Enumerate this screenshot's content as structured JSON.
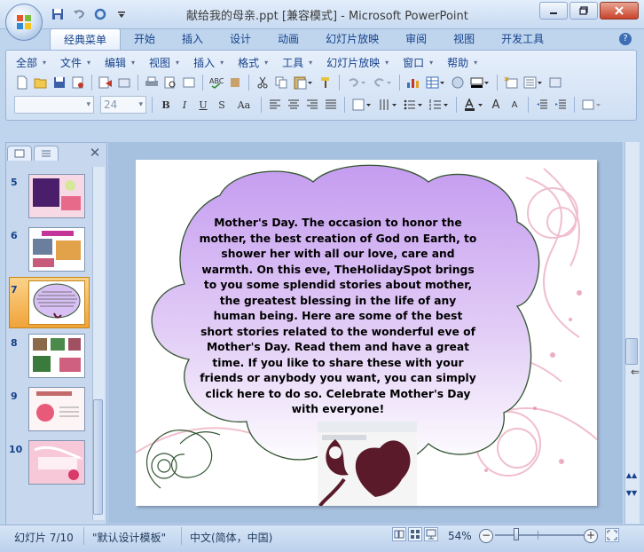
{
  "window": {
    "title": "献给我的母亲.ppt [兼容模式] - Microsoft PowerPoint",
    "controls": [
      "minimize",
      "restore",
      "close"
    ]
  },
  "quick_access": [
    "save-icon",
    "undo-icon",
    "redo-icon",
    "customize-icon"
  ],
  "ribbon": {
    "tabs": [
      {
        "label": "经典菜单",
        "active": true
      },
      {
        "label": "开始",
        "active": false
      },
      {
        "label": "插入",
        "active": false
      },
      {
        "label": "设计",
        "active": false
      },
      {
        "label": "动画",
        "active": false
      },
      {
        "label": "幻灯片放映",
        "active": false
      },
      {
        "label": "审阅",
        "active": false
      },
      {
        "label": "视图",
        "active": false
      },
      {
        "label": "开发工具",
        "active": false
      }
    ],
    "help_label": "?",
    "menus": [
      "全部",
      "文件",
      "编辑",
      "视图",
      "插入",
      "格式",
      "工具",
      "幻灯片放映",
      "窗口",
      "帮助"
    ],
    "font_name": "",
    "font_size": "24",
    "toolbar1_icons": [
      "new-icon",
      "open-icon",
      "save-icon",
      "permission-icon",
      "send-icon",
      "publish-icon",
      "print-icon",
      "print-preview-icon",
      "research-icon",
      "spelling-icon",
      "cut-icon",
      "copy-icon",
      "paste-icon",
      "format-painter-icon",
      "undo-icon",
      "redo-icon",
      "chart-icon",
      "table-icon",
      "picture-icon",
      "color-icon",
      "new-slide-icon",
      "layout-icon",
      "zoom-icon"
    ],
    "toolbar2_icons": [
      "bold-icon",
      "italic-icon",
      "underline-icon",
      "shadow-icon",
      "change-case-icon",
      "align-left-icon",
      "align-center-icon",
      "align-right-icon",
      "justify-icon",
      "columns-icon",
      "text-direction-icon",
      "bullets-icon",
      "numbering-icon",
      "font-color-icon",
      "grow-font-icon",
      "shrink-font-icon",
      "decrease-indent-icon",
      "increase-indent-icon",
      "design-icon"
    ],
    "button_letters": {
      "bold": "B",
      "italic": "I",
      "underline": "U",
      "shadow": "S",
      "case": "Aa",
      "grow": "A",
      "shrink": "A"
    }
  },
  "slides_pane": {
    "tab_outline": "slides-tab",
    "tab_slides": "outline-tab",
    "slides": [
      {
        "number": "5",
        "selected": false
      },
      {
        "number": "6",
        "selected": false
      },
      {
        "number": "7",
        "selected": true
      },
      {
        "number": "8",
        "selected": false
      },
      {
        "number": "9",
        "selected": false
      },
      {
        "number": "10",
        "selected": false
      }
    ]
  },
  "slide": {
    "body_text": "Mother's Day. The occasion to honor the mother, the best creation of God on Earth, to shower her with all our love, care and warmth. On this eve, TheHolidaySpot brings to you some splendid stories about mother, the greatest blessing in the life of any human being. Here are some of the best short stories related to the wonderful eve of Mother's Day. Read them and have a great time. If you like to share these with your friends or anybody you want, you can simply click here to do so. Celebrate Mother's Day with everyone!",
    "cloud_colors": {
      "top": "#c59cf0",
      "bottom": "#ffffff",
      "outline": "#335533"
    },
    "heart_color": "#5a1a2a"
  },
  "status": {
    "slide_info": "幻灯片 7/10",
    "theme": "\"默认设计模板\"",
    "language": "中文(简体，中国)",
    "zoom": "54%",
    "zoom_level_percent": 54
  },
  "colors": {
    "chrome": "#bfd5ee",
    "accent": "#15428b",
    "selected_thumb": "#f1a33a"
  }
}
